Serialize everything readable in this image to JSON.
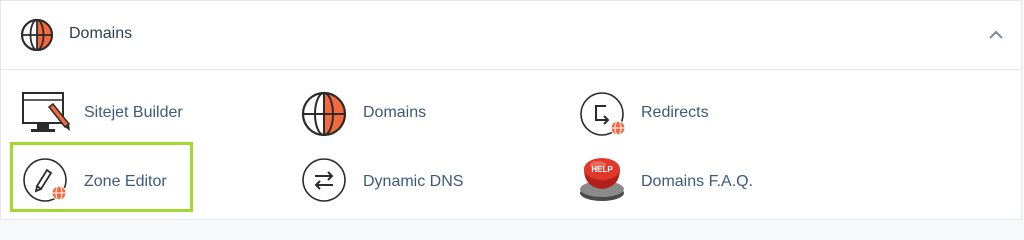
{
  "colors": {
    "accent_orange": "#f26a3d",
    "link_blue": "#3d5a7a",
    "highlight_green": "#a3d92f"
  },
  "header": {
    "title": "Domains",
    "icon": "globe-icon",
    "collapse_icon": "chevron-up-icon"
  },
  "items": [
    {
      "label": "Sitejet Builder",
      "icon": "sitejet-builder-icon"
    },
    {
      "label": "Domains",
      "icon": "globe-icon"
    },
    {
      "label": "Redirects",
      "icon": "redirects-icon"
    },
    {
      "label": "Zone Editor",
      "icon": "zone-editor-icon",
      "highlighted": true
    },
    {
      "label": "Dynamic DNS",
      "icon": "dynamic-dns-icon"
    },
    {
      "label": "Domains F.A.Q.",
      "icon": "help-button-icon",
      "badge_text": "HELP"
    }
  ]
}
